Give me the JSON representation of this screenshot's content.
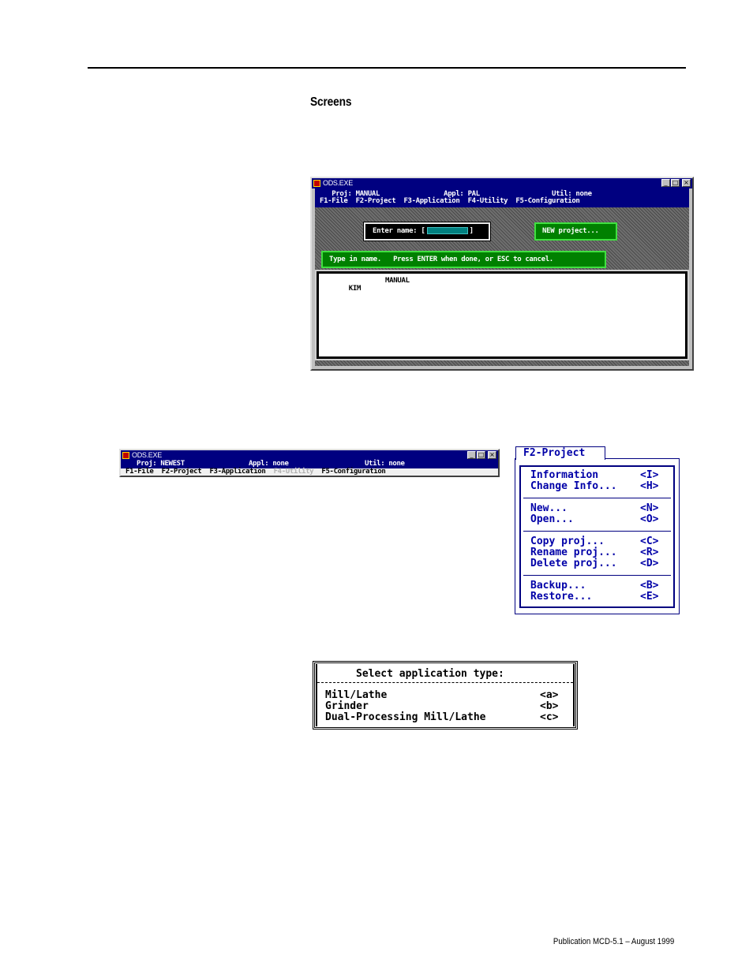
{
  "heading": "Screens",
  "window1": {
    "title": "ODS.EXE",
    "status_proj": "Proj: MANUAL",
    "status_appl": "Appl: PAL",
    "status_util": "Util: none",
    "menu": [
      "F1-File",
      "F2-Project",
      "F3-Application",
      "F4-Utility",
      "F5-Configuration"
    ],
    "enter_name_label": "Enter name:",
    "new_project_label": "NEW project...",
    "instruction": "Type in name.   Press ENTER when done, or ESC to cancel.",
    "list": [
      {
        "col1": "KIM",
        "col2": "MANUAL"
      }
    ]
  },
  "window2": {
    "title": "ODS.EXE",
    "status_proj": "Proj: NEWEST",
    "status_appl": "Appl: none",
    "status_util": "Util: none",
    "menu": [
      "F1-File",
      "F2-Project",
      "F3-Application",
      "F4-Utility",
      "F5-Configuration"
    ],
    "disabled_menu_index": 3
  },
  "f2_menu": {
    "title": "F2-Project",
    "groups": [
      [
        {
          "label": "Information",
          "key": "<I>"
        },
        {
          "label": "Change Info...",
          "key": "<H>"
        }
      ],
      [
        {
          "label": "New...",
          "key": "<N>"
        },
        {
          "label": "Open...",
          "key": "<O>"
        }
      ],
      [
        {
          "label": "Copy proj...",
          "key": "<C>"
        },
        {
          "label": "Rename proj...",
          "key": "<R>"
        },
        {
          "label": "Delete proj...",
          "key": "<D>"
        }
      ],
      [
        {
          "label": "Backup...",
          "key": "<B>"
        },
        {
          "label": "Restore...",
          "key": "<E>"
        }
      ]
    ]
  },
  "select_app": {
    "title": "Select application type:",
    "items": [
      {
        "label": "Mill/Lathe",
        "key": "<a>"
      },
      {
        "label": "Grinder",
        "key": "<b>"
      },
      {
        "label": "Dual-Processing Mill/Lathe",
        "key": "<c>"
      }
    ]
  },
  "footer": "Publication MCD-5.1 – August 1999",
  "colors": {
    "dos_blue": "#000080",
    "dos_green": "#008000",
    "menu_text": "#0000a8",
    "win_gray": "#c0c0c0"
  }
}
